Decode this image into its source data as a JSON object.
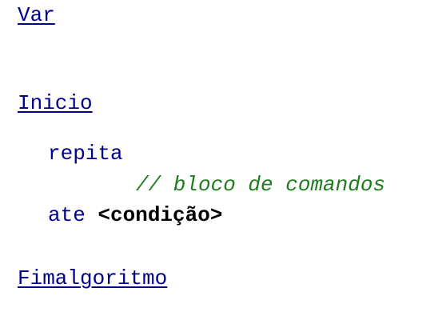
{
  "code": {
    "var_keyword": "Var",
    "inicio_keyword": "Inicio",
    "repita_keyword": "repita",
    "comment": "// bloco de comandos",
    "ate_keyword": "ate",
    "condition": "<condição>",
    "fimalgoritmo_keyword": "Fimalgoritmo"
  },
  "colors": {
    "keyword": "#00008b",
    "comment": "#1e7b1e",
    "condition": "#000000",
    "background": "#ffffff"
  }
}
